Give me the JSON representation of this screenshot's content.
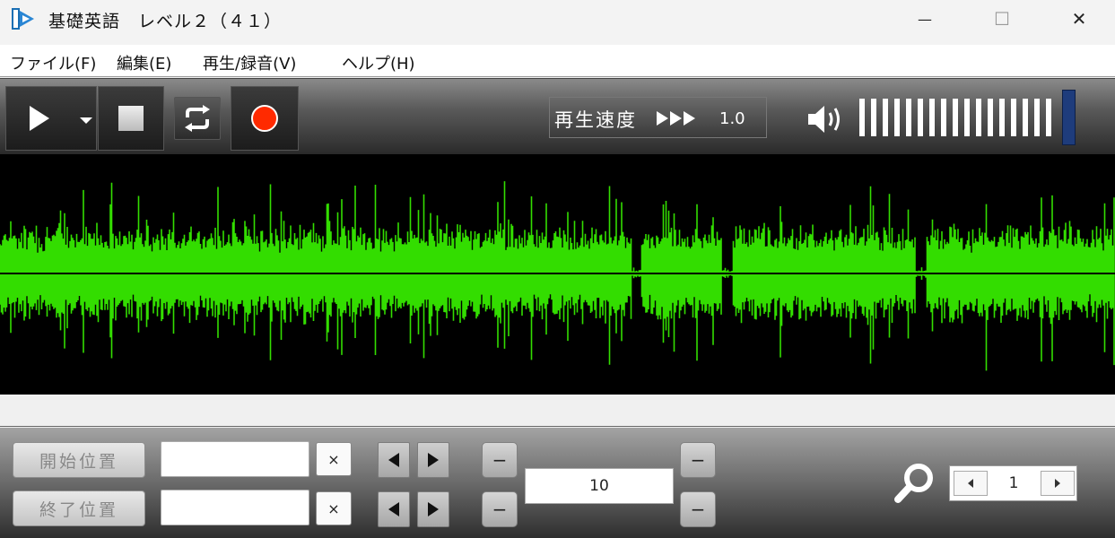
{
  "window": {
    "title": "基礎英語　レベル２（４１）",
    "minimize_glyph": "—",
    "maximize_glyph": "☐",
    "close_glyph": "✕"
  },
  "menu": [
    {
      "label": "ファイル(F)"
    },
    {
      "label": "編集(E)"
    },
    {
      "label": "再生/録音(V)"
    },
    {
      "label": "ヘルプ(H)"
    }
  ],
  "toolbar": {
    "icons": [
      "play-icon",
      "dropdown-caret-icon",
      "stop-icon",
      "loop-icon",
      "record-icon"
    ],
    "speed_label": "再生速度",
    "speed_value": "1.0",
    "speed_icon": "fast-forward-icon",
    "volume_icon": "speaker-icon",
    "volume_level": 1.0,
    "record_color": "#ff2a00",
    "volume_knob_color": "#1e3c7c"
  },
  "waveform": {
    "color": "#33dd00",
    "background": "#000000"
  },
  "range": {
    "start_label": "開始位置",
    "end_label": "終了位置",
    "start_value": "",
    "end_value": "",
    "clear_glyph": "×",
    "minus_glyph": "−",
    "interval_value": "10"
  },
  "zoom": {
    "icon": "magnifier-icon",
    "page_value": "1"
  }
}
